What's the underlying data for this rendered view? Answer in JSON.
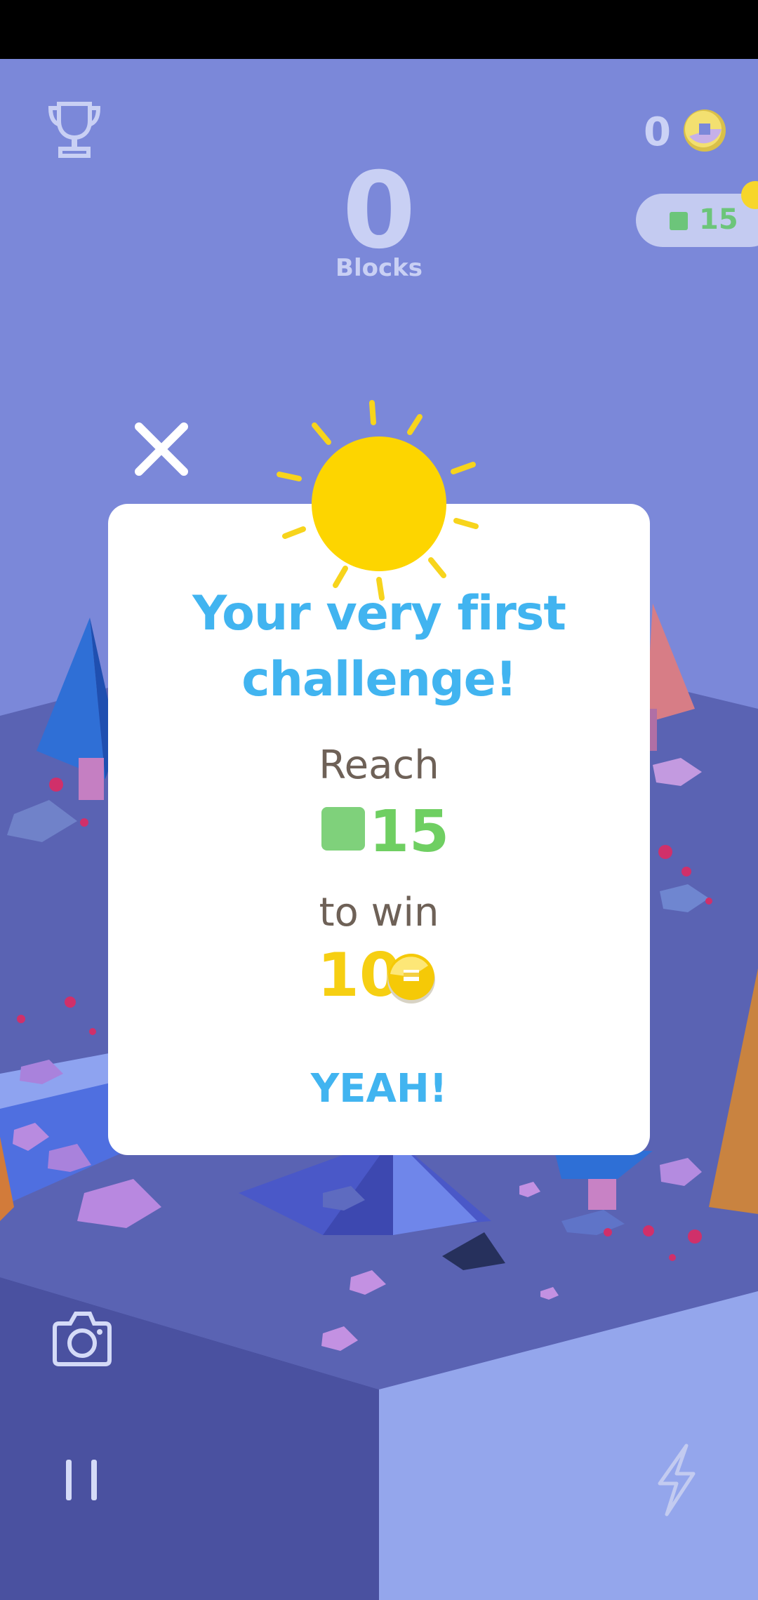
{
  "hud": {
    "score": "0",
    "score_label": "Blocks",
    "coins": "0",
    "target": "15"
  },
  "modal": {
    "title_line1": "Your very first",
    "title_line2": "challenge!",
    "reach_label": "Reach",
    "goal_value": "15",
    "win_label": "to win",
    "reward_value": "10",
    "confirm_label": "YEAH!"
  },
  "icons": [
    "trophy-icon",
    "coin-icon",
    "close-icon",
    "sun-icon",
    "camera-icon",
    "pause-icon",
    "lightning-icon"
  ],
  "colors": {
    "sky": "#7b88d9",
    "title_blue": "#41b4f0",
    "goal_green": "#6fcf62",
    "coin_yellow": "#f6cf12"
  }
}
